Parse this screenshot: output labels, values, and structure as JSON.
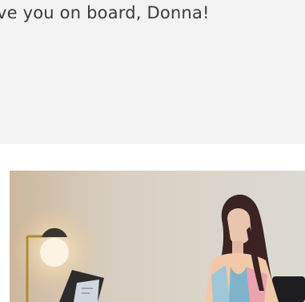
{
  "welcome_banner": {
    "message": "ve you on board, Donna!",
    "background_color": "#f2f3f2",
    "text_color": "#3b3b3b"
  },
  "photo": {
    "subject": "woman working at desk with laptop beside lit globe floor lamp"
  }
}
